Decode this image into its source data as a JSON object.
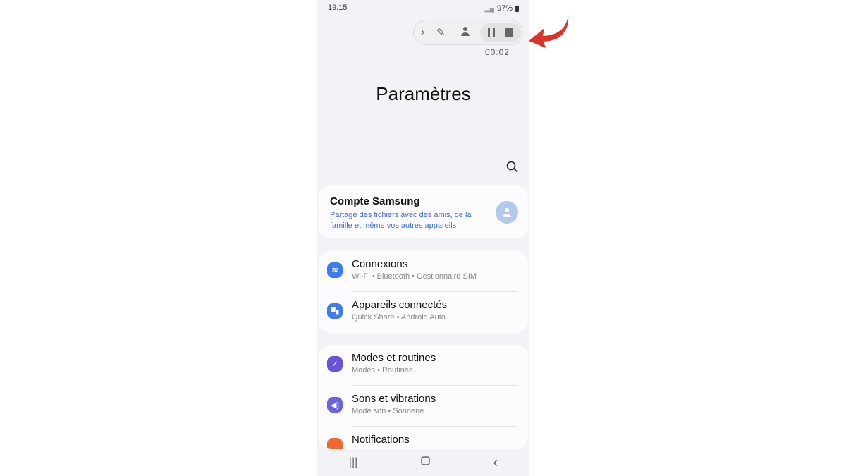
{
  "status": {
    "time": "19:15",
    "battery": "97%"
  },
  "recorder": {
    "timer": "00:02",
    "icons": [
      "chevron-right-icon",
      "pencil-icon",
      "person-icon",
      "pause-icon",
      "stop-icon"
    ]
  },
  "page_title": "Paramètres",
  "account": {
    "title": "Compte Samsung",
    "subtitle": "Partage des fichiers avec des amis, de la famille et même vos autres appareils"
  },
  "groups": [
    [
      {
        "name": "Connexions",
        "desc": "Wi-Fi  •  Bluetooth  •  Gestionnaire SIM",
        "color": "#3d7cf0"
      },
      {
        "name": "Appareils connectés",
        "desc": "Quick Share  •  Android Auto",
        "color": "#3d7cf0"
      }
    ],
    [
      {
        "name": "Modes et routines",
        "desc": "Modes  •  Routines",
        "color": "#6a52d9"
      },
      {
        "name": "Sons et vibrations",
        "desc": "Mode son  •  Sonnerie",
        "color": "#6a63dc"
      },
      {
        "name": "Notifications",
        "desc": "",
        "color": "#ee6a2f"
      }
    ]
  ],
  "colors": {
    "annotation_arrow": "#d9342b",
    "link": "#3b6fd1"
  }
}
